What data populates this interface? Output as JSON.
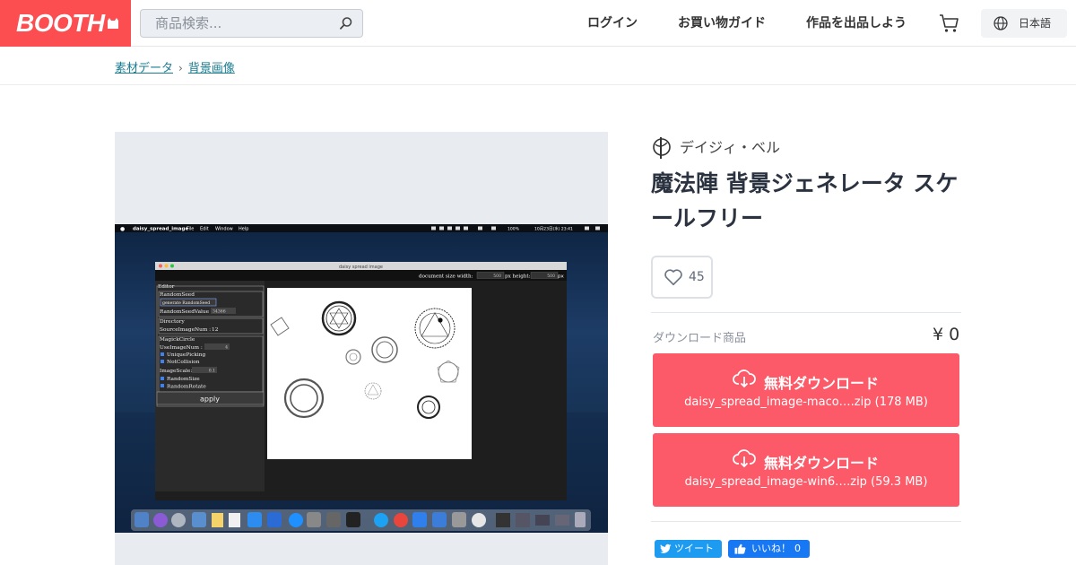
{
  "header": {
    "logo_text": "BOOTH",
    "search_placeholder": "商品検索...",
    "nav": {
      "login": "ログイン",
      "guide": "お買い物ガイド",
      "sell": "作品を出品しよう"
    },
    "language": "日本語"
  },
  "breadcrumb": {
    "items": [
      "素材データ",
      "背景画像"
    ],
    "separator": "›"
  },
  "screenshot_content": {
    "menubar": {
      "app": "daisy_spread_image",
      "items": [
        "File",
        "Edit",
        "Window",
        "Help"
      ],
      "clock": "10月23日(水) 23:41",
      "battery": "100%"
    },
    "window_title": "daisy spread image",
    "doc_size": {
      "width_label": "document size width:",
      "width_value": "500",
      "height_label": "px height:",
      "height_value": "500",
      "unit": "px"
    },
    "editor": {
      "title": "Editor",
      "random_seed": {
        "legend": "RandomSeed",
        "button": "generate RandomSeed",
        "value_label": "RandomSeedValue",
        "value": "34366"
      },
      "directory": {
        "legend": "Directory",
        "source_label": "SourceImageNum :",
        "source_value": "12"
      },
      "magick_circle": {
        "legend": "MagickCircle",
        "use_label": "UseImageNum :",
        "use_value": "4",
        "unique": "UniquePicking",
        "collision": "NotCollision",
        "scale_label": "ImageScale:",
        "scale_value": "0.1",
        "random_size": "RandomSize",
        "random_rotate": "RandomRotate"
      },
      "apply": "apply"
    }
  },
  "product": {
    "shop_name": "デイジィ・ベル",
    "title": "魔法陣 背景ジェネレータ スケールフリー",
    "likes": "45",
    "download_label": "ダウンロード商品",
    "price": "¥ 0",
    "downloads": [
      {
        "label": "無料ダウンロード",
        "file": "daisy_spread_image-maco….zip (178 MB)"
      },
      {
        "label": "無料ダウンロード",
        "file": "daisy_spread_image-win6….zip (59.3 MB)"
      }
    ]
  },
  "social": {
    "tweet": "ツイート",
    "like": "いいね！",
    "like_count": "0"
  },
  "colors": {
    "brand": "#fc4d50",
    "download": "#fc5a68",
    "twitter": "#1d9bf0",
    "facebook": "#1877f2",
    "link": "#1a7c90"
  }
}
